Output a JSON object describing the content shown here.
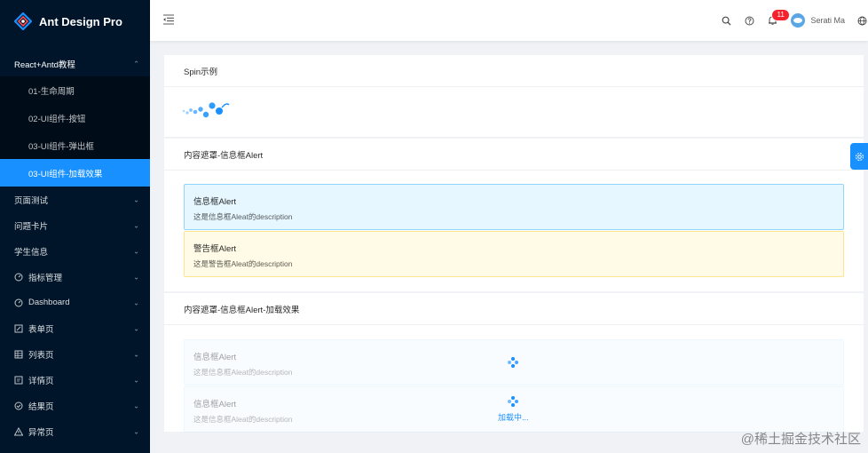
{
  "app": {
    "title": "Ant Design Pro"
  },
  "sidebar": {
    "open_group": {
      "label": "React+Antd教程"
    },
    "sub_items": [
      {
        "label": "01-生命周期"
      },
      {
        "label": "02-UI组件-按钮"
      },
      {
        "label": "03-UI组件-弹出框"
      },
      {
        "label": "03-UI组件-加载效果"
      }
    ],
    "items": [
      {
        "label": "页面测试",
        "icon": ""
      },
      {
        "label": "问题卡片",
        "icon": ""
      },
      {
        "label": "学生信息",
        "icon": ""
      },
      {
        "label": "指标管理",
        "icon": "dashboard-icon"
      },
      {
        "label": "Dashboard",
        "icon": "dashboard-icon"
      },
      {
        "label": "表单页",
        "icon": "form-icon"
      },
      {
        "label": "列表页",
        "icon": "table-icon"
      },
      {
        "label": "详情页",
        "icon": "profile-icon"
      },
      {
        "label": "结果页",
        "icon": "check-circle-icon"
      },
      {
        "label": "异常页",
        "icon": "warning-icon"
      }
    ]
  },
  "header": {
    "notification_count": "11",
    "user_name": "Serati Ma"
  },
  "cards": {
    "spin": {
      "title": "Spin示例"
    },
    "alert_mask": {
      "title": "内容遮罩-信息框Alert",
      "info": {
        "message": "信息框Alert",
        "description": "这是信息框Aleat的description"
      },
      "warning": {
        "message": "警告框Alert",
        "description": "这是警告框Aleat的description"
      }
    },
    "alert_loading": {
      "title": "内容遮罩-信息框Alert-加载效果",
      "info": {
        "message": "信息框Alert",
        "description": "这是信息框Aleat的description"
      },
      "second": {
        "message": "信息框Alert",
        "description": "这是信息框Aleat的description"
      },
      "loading_tip": "加载中..."
    }
  },
  "watermark": "@稀土掘金技术社区",
  "colors": {
    "primary": "#1890ff",
    "sider": "#001529",
    "badge": "#f5222d"
  }
}
